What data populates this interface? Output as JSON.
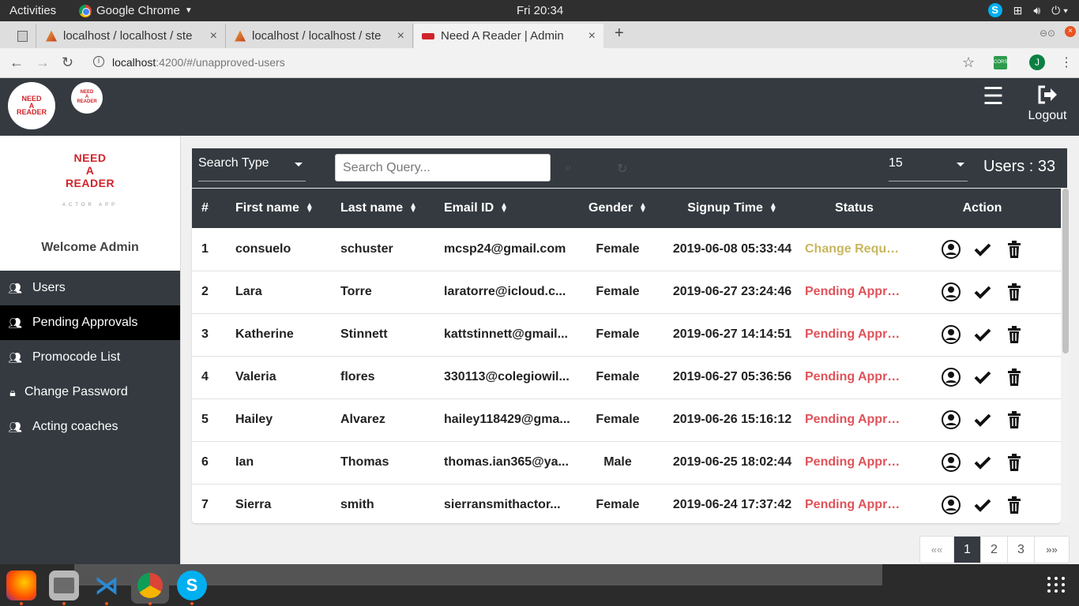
{
  "system": {
    "activities": "Activities",
    "app_name": "Google Chrome",
    "clock": "Fri 20:34"
  },
  "browser": {
    "tabs": [
      {
        "title": "localhost / localhost / ste"
      },
      {
        "title": "localhost / localhost / ste"
      },
      {
        "title": "Need A Reader | Admin",
        "active": true
      }
    ],
    "url_host": "localhost",
    "url_rest": ":4200/#/unapproved-users",
    "profile_initial": "J",
    "extension_label": "CORS"
  },
  "header": {
    "logout_label": "Logout"
  },
  "brand": {
    "line1": "NEED",
    "line2": "A",
    "line3": "READER",
    "tagline": "ACTOR APP",
    "welcome": "Welcome Admin"
  },
  "sidebar": {
    "items": [
      {
        "label": "Users",
        "icon": "users-icon"
      },
      {
        "label": "Pending Approvals",
        "icon": "users-icon",
        "active": true
      },
      {
        "label": "Promocode List",
        "icon": "users-icon"
      },
      {
        "label": "Change Password",
        "icon": "lock-icon"
      },
      {
        "label": "Acting coaches",
        "icon": "users-icon"
      }
    ]
  },
  "filter": {
    "search_type_label": "Search Type",
    "search_placeholder": "Search Query...",
    "page_size": "15",
    "user_count": "Users : 33"
  },
  "table": {
    "headers": {
      "num": "#",
      "first_name": "First name",
      "last_name": "Last name",
      "email": "Email ID",
      "gender": "Gender",
      "signup": "Signup Time",
      "status": "Status",
      "action": "Action"
    },
    "rows": [
      {
        "num": "1",
        "first": "consuelo",
        "last": "schuster",
        "email": "mcsp24@gmail.com",
        "gender": "Female",
        "signup": "2019-06-08 05:33:44",
        "status": "Change Request"
      },
      {
        "num": "2",
        "first": "Lara",
        "last": "Torre",
        "email": "laratorre@icloud.c...",
        "gender": "Female",
        "signup": "2019-06-27 23:24:46",
        "status": "Pending Approval"
      },
      {
        "num": "3",
        "first": "Katherine",
        "last": "Stinnett",
        "email": "kattstinnett@gmail...",
        "gender": "Female",
        "signup": "2019-06-27 14:14:51",
        "status": "Pending Approval"
      },
      {
        "num": "4",
        "first": "Valeria",
        "last": "flores",
        "email": "330113@colegiowil...",
        "gender": "Female",
        "signup": "2019-06-27 05:36:56",
        "status": "Pending Approval"
      },
      {
        "num": "5",
        "first": "Hailey",
        "last": "Alvarez",
        "email": "hailey118429@gma...",
        "gender": "Female",
        "signup": "2019-06-26 15:16:12",
        "status": "Pending Approval"
      },
      {
        "num": "6",
        "first": "Ian",
        "last": "Thomas",
        "email": "thomas.ian365@ya...",
        "gender": "Male",
        "signup": "2019-06-25 18:02:44",
        "status": "Pending Approval"
      },
      {
        "num": "7",
        "first": "Sierra",
        "last": "smith",
        "email": "sierransmithactor...",
        "gender": "Female",
        "signup": "2019-06-24 17:37:42",
        "status": "Pending Approval"
      }
    ]
  },
  "pagination": {
    "first": "««",
    "pages": [
      "1",
      "2",
      "3"
    ],
    "last": "»»",
    "current": "1"
  },
  "colors": {
    "dark": "#343a40",
    "change_request": "#c8b75d",
    "pending": "#e0535a"
  }
}
